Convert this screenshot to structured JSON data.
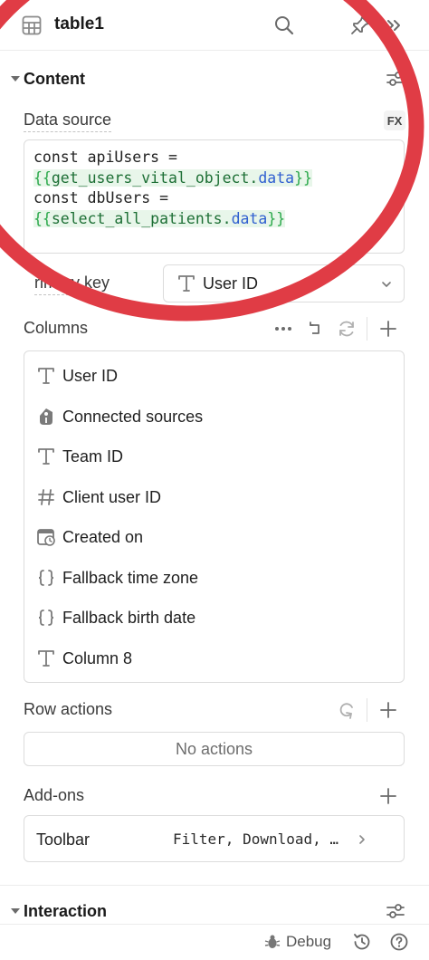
{
  "header": {
    "title": "table1",
    "icons": [
      "table-icon",
      "search-icon",
      "pin-icon",
      "collapse-icon"
    ]
  },
  "content": {
    "section_label": "Content",
    "data_source": {
      "label": "Data source",
      "fx_label": "FX",
      "code": {
        "line1": "const apiUsers =",
        "line2_open": "{{",
        "line2_expr": "get_users_vital_object.",
        "line2_prop": "data",
        "line2_close": "}}",
        "line3": "const dbUsers =",
        "line4_open": "{{",
        "line4_expr": "select_all_patients.",
        "line4_prop": "data",
        "line4_close": "}}"
      }
    },
    "primary_key": {
      "label": "rimary key",
      "value": "User ID"
    },
    "columns": {
      "label": "Columns",
      "items": [
        {
          "label": "User ID",
          "icon": "text-type-icon"
        },
        {
          "label": "Connected sources",
          "icon": "tag-icon"
        },
        {
          "label": "Team ID",
          "icon": "text-type-icon"
        },
        {
          "label": "Client user ID",
          "icon": "hash-icon"
        },
        {
          "label": "Created on",
          "icon": "calendar-clock-icon"
        },
        {
          "label": "Fallback time zone",
          "icon": "braces-icon"
        },
        {
          "label": "Fallback birth date",
          "icon": "braces-icon"
        },
        {
          "label": "Column 8",
          "icon": "text-type-icon"
        }
      ]
    },
    "row_actions": {
      "label": "Row actions",
      "empty_text": "No actions"
    },
    "add_ons": {
      "label": "Add-ons",
      "toolbar_label": "Toolbar",
      "toolbar_value": "Filter, Download, …"
    }
  },
  "interaction": {
    "section_label": "Interaction"
  },
  "footer": {
    "debug_label": "Debug"
  },
  "colors": {
    "annotation_circle": "#e03c45",
    "code_highlight_bg": "#e8f6ea",
    "code_brace": "#2aa84a",
    "code_prop": "#2f5fd0"
  }
}
